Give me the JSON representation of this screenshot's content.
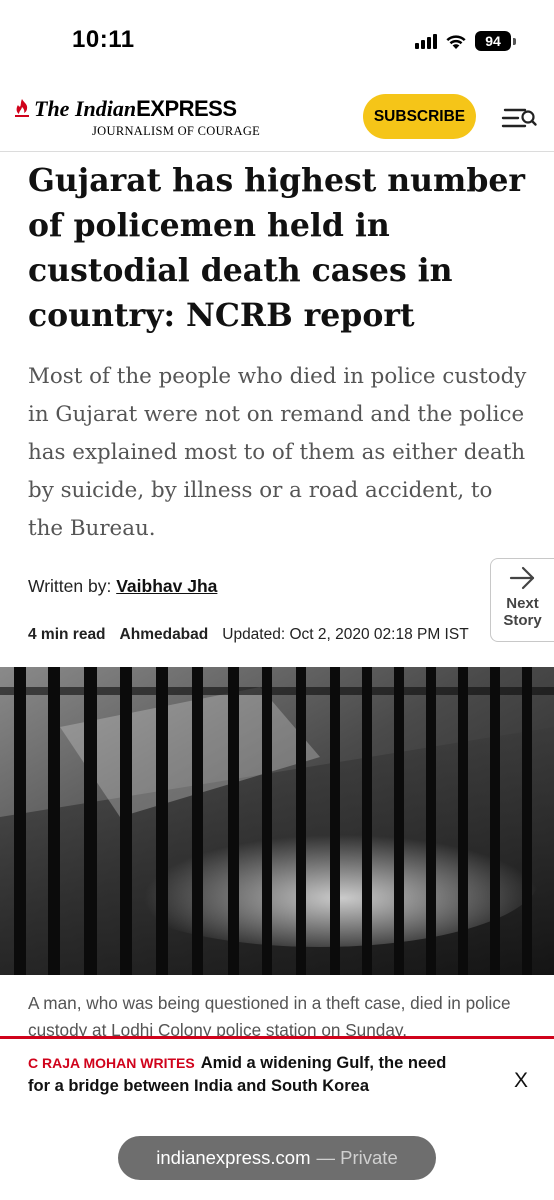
{
  "status_bar": {
    "time": "10:11",
    "battery": "94",
    "icons": [
      "signal-icon",
      "wifi-icon",
      "battery-icon"
    ]
  },
  "header": {
    "logo": {
      "brand_the_indian": "The Indian",
      "brand_express": "EXPRESS",
      "tagline": "JOURNALISM OF COURAGE"
    },
    "subscribe_label": "SUBSCRIBE",
    "menu_icon": "menu-icon",
    "accent_color": "#f5c518"
  },
  "article": {
    "headline": "Gujarat has highest number of policemen held in custodial death cases in country: NCRB report",
    "synopsis": "Most of the people who died in police custody in Gujarat were not on remand and the police has explained most to of them as either death by suicide, by illness or a road accident, to the Bureau.",
    "byline_prefix": "Written by:",
    "author": "Vaibhav Jha",
    "read_time": "4 min read",
    "location": "Ahmedabad",
    "updated": "Updated: Oct 2, 2020 02:18 PM IST",
    "image_icon": "jail-bars-image",
    "caption": "A man, who was being questioned in a theft case, died in police custody at Lodhi Colony police station on Sunday."
  },
  "next_story": {
    "label_line1": "Next",
    "label_line2": "Story",
    "icon": "arrow-right-icon"
  },
  "promo": {
    "kicker": "C Raja Mohan writes",
    "text": "Amid a widening Gulf, the need for a bridge between India and South Korea",
    "close_label": "X",
    "accent_color": "#d0021b"
  },
  "url_bar": {
    "domain": "indianexpress.com",
    "mode": "— Private"
  }
}
